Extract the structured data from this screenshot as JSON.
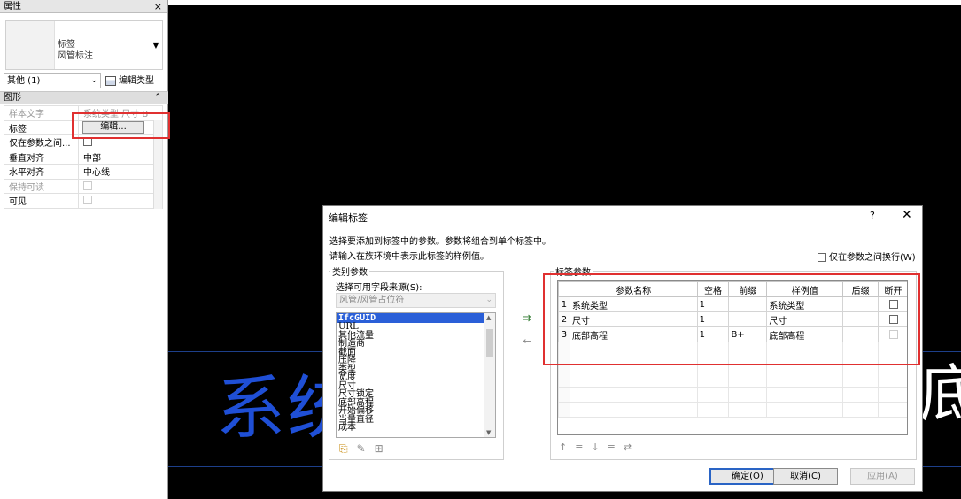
{
  "properties": {
    "title": "属性",
    "close": "×",
    "type_line1": "标签",
    "type_line2": "风管标注",
    "instance_selector": "其他 (1)",
    "edit_type": "编辑类型",
    "group_name": "图形",
    "rows": [
      {
        "key": "样本文字",
        "value": "系统类型 尺寸 B"
      },
      {
        "key": "标签",
        "value": "编辑..."
      },
      {
        "key": "仅在参数之间...",
        "value": ""
      },
      {
        "key": "垂直对齐",
        "value": "中部"
      },
      {
        "key": "水平对齐",
        "value": "中心线"
      },
      {
        "key": "保持可读",
        "value": ""
      },
      {
        "key": "可见",
        "value": ""
      }
    ]
  },
  "canvas": {
    "big_text": "系统",
    "right_text": "底"
  },
  "dialog": {
    "title": "编辑标签",
    "help": "?",
    "close": "✕",
    "intro1": "选择要添加到标签中的参数。参数将组合到单个标签中。",
    "intro2": "请输入在族环境中表示此标签的样例值。",
    "wrap_label": "仅在参数之间换行(W)",
    "category_group": "类别参数",
    "source_label": "选择可用字段来源(S):",
    "source_value": "风管/风管占位符",
    "fields": [
      "IfcGUID",
      "URL",
      "其他流量",
      "制造商",
      "截面",
      "压降",
      "类型",
      "宽度",
      "尺寸",
      "尺寸锁定",
      "底部高程",
      "开始偏移",
      "当量直径",
      "成本"
    ],
    "label_group": "标签参数",
    "columns": [
      "参数名称",
      "空格",
      "前缀",
      "样例值",
      "后缀",
      "断开"
    ],
    "params": [
      {
        "n": "1",
        "name": "系统类型",
        "space": "1",
        "prefix": "",
        "sample": "系统类型",
        "suffix": ""
      },
      {
        "n": "2",
        "name": "尺寸",
        "space": "1",
        "prefix": "",
        "sample": "尺寸",
        "suffix": ""
      },
      {
        "n": "3",
        "name": "底部高程",
        "space": "1",
        "prefix": "B+",
        "sample": "底部高程",
        "suffix": ""
      }
    ],
    "ok": "确定(O)",
    "cancel": "取消(C)",
    "apply": "应用(A)"
  }
}
